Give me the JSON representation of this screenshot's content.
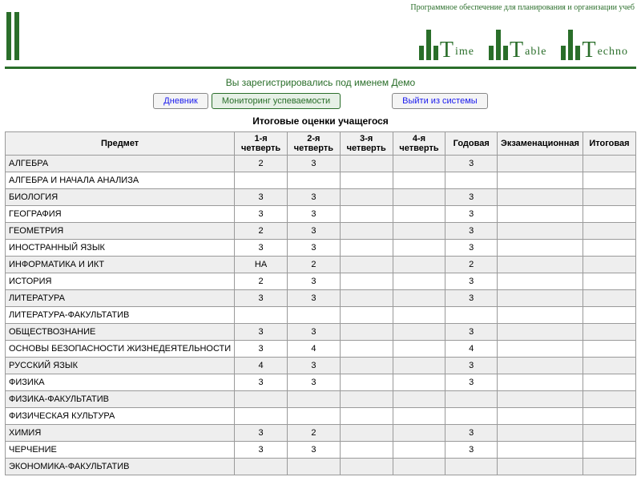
{
  "header": {
    "tagline": "Программное обеспечение для планирования и организации учеб",
    "logos": [
      {
        "letter": "T",
        "word": "ime"
      },
      {
        "letter": "T",
        "word": "able"
      },
      {
        "letter": "T",
        "word": "echno"
      }
    ]
  },
  "user_line": "Вы зарегистрировались под именем Демо",
  "nav": {
    "diary": "Дневник",
    "monitoring": "Мониторинг успеваемости",
    "logout": "Выйти из системы"
  },
  "section_title": "Итоговые оценки учащегося",
  "columns": [
    "Предмет",
    "1-я четверть",
    "2-я четверть",
    "3-я четверть",
    "4-я четверть",
    "Годовая",
    "Экзаменационная",
    "Итоговая"
  ],
  "rows": [
    {
      "subject": "АЛГЕБРА",
      "g": [
        "2",
        "3",
        "",
        "",
        "3",
        "",
        ""
      ]
    },
    {
      "subject": "АЛГЕБРА И НАЧАЛА АНАЛИЗА",
      "g": [
        "",
        "",
        "",
        "",
        "",
        "",
        ""
      ]
    },
    {
      "subject": "БИОЛОГИЯ",
      "g": [
        "3",
        "3",
        "",
        "",
        "3",
        "",
        ""
      ]
    },
    {
      "subject": "ГЕОГРАФИЯ",
      "g": [
        "3",
        "3",
        "",
        "",
        "3",
        "",
        ""
      ]
    },
    {
      "subject": "ГЕОМЕТРИЯ",
      "g": [
        "2",
        "3",
        "",
        "",
        "3",
        "",
        ""
      ]
    },
    {
      "subject": "ИНОСТРАННЫЙ ЯЗЫК",
      "g": [
        "3",
        "3",
        "",
        "",
        "3",
        "",
        ""
      ]
    },
    {
      "subject": "ИНФОРМАТИКА И ИКТ",
      "g": [
        "НА",
        "2",
        "",
        "",
        "2",
        "",
        ""
      ]
    },
    {
      "subject": "ИСТОРИЯ",
      "g": [
        "2",
        "3",
        "",
        "",
        "3",
        "",
        ""
      ]
    },
    {
      "subject": "ЛИТЕРАТУРА",
      "g": [
        "3",
        "3",
        "",
        "",
        "3",
        "",
        ""
      ]
    },
    {
      "subject": "ЛИТЕРАТУРА-ФАКУЛЬТАТИВ",
      "g": [
        "",
        "",
        "",
        "",
        "",
        "",
        ""
      ]
    },
    {
      "subject": "ОБЩЕСТВОЗНАНИЕ",
      "g": [
        "3",
        "3",
        "",
        "",
        "3",
        "",
        ""
      ]
    },
    {
      "subject": "ОСНОВЫ БЕЗОПАСНОСТИ ЖИЗНЕДЕЯТЕЛЬНОСТИ",
      "g": [
        "3",
        "4",
        "",
        "",
        "4",
        "",
        ""
      ]
    },
    {
      "subject": "РУССКИЙ ЯЗЫК",
      "g": [
        "4",
        "3",
        "",
        "",
        "3",
        "",
        ""
      ]
    },
    {
      "subject": "ФИЗИКА",
      "g": [
        "3",
        "3",
        "",
        "",
        "3",
        "",
        ""
      ]
    },
    {
      "subject": "ФИЗИКА-ФАКУЛЬТАТИВ",
      "g": [
        "",
        "",
        "",
        "",
        "",
        "",
        ""
      ]
    },
    {
      "subject": "ФИЗИЧЕСКАЯ КУЛЬТУРА",
      "g": [
        "",
        "",
        "",
        "",
        "",
        "",
        ""
      ]
    },
    {
      "subject": "ХИМИЯ",
      "g": [
        "3",
        "2",
        "",
        "",
        "3",
        "",
        ""
      ]
    },
    {
      "subject": "ЧЕРЧЕНИЕ",
      "g": [
        "3",
        "3",
        "",
        "",
        "3",
        "",
        ""
      ]
    },
    {
      "subject": "ЭКОНОМИКА-ФАКУЛЬТАТИВ",
      "g": [
        "",
        "",
        "",
        "",
        "",
        "",
        ""
      ]
    }
  ]
}
